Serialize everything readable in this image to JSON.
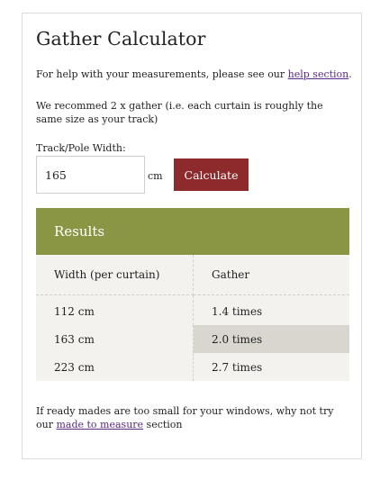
{
  "title": "Gather Calculator",
  "help": {
    "prefix": "For help with your measurements, please see our ",
    "link": "help section",
    "suffix": "."
  },
  "recommend": "We recommed 2 x gather (i.e. each curtain is roughly the same size as your track)",
  "width_label": "Track/Pole Width:",
  "width_value": "165",
  "unit": "cm",
  "calculate_label": "Calculate",
  "results": {
    "title": "Results",
    "col_width": "Width (per curtain)",
    "col_gather": "Gather",
    "rows": [
      {
        "width": "112 cm",
        "gather": "1.4 times"
      },
      {
        "width": "163 cm",
        "gather": "2.0 times"
      },
      {
        "width": "223 cm",
        "gather": "2.7 times"
      }
    ]
  },
  "footer": {
    "prefix": "If ready mades are too small for your windows, why not try our ",
    "link": "made to measure",
    "suffix": " section"
  },
  "colors": {
    "button": "#8c2a2c",
    "results_header": "#8a9643",
    "highlight_row": "#d9d5cf",
    "link": "#5b2a86"
  }
}
